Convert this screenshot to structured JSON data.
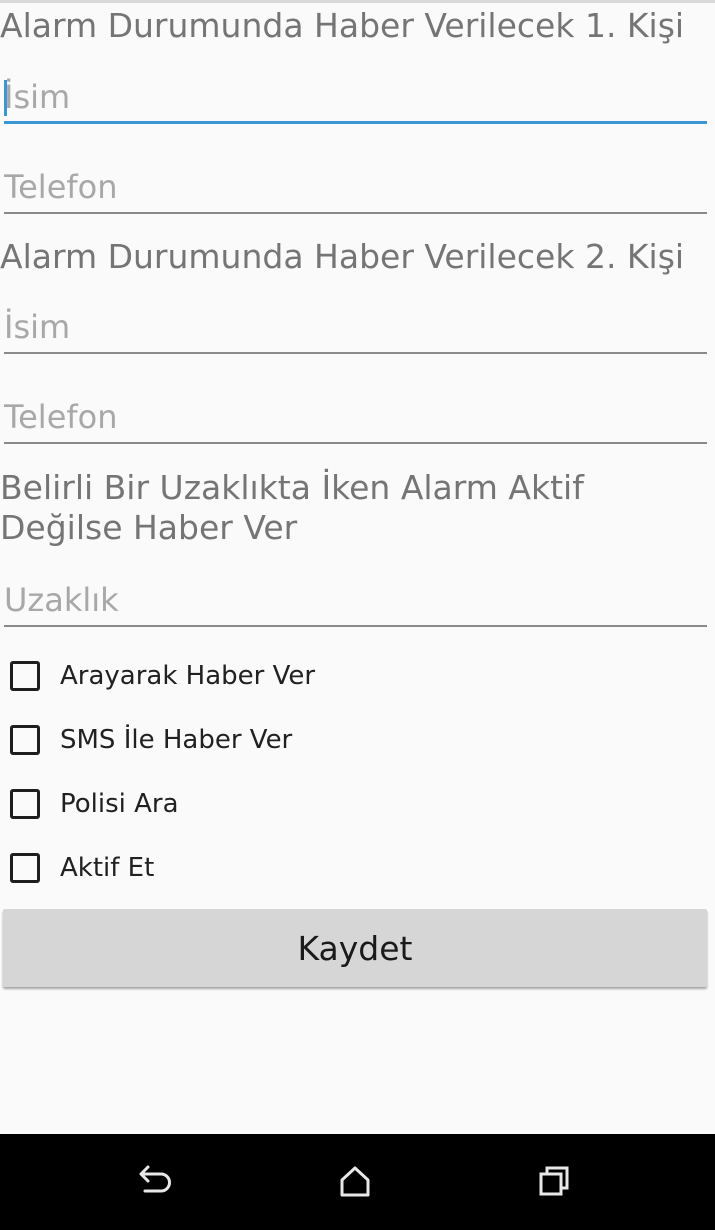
{
  "contact1": {
    "title": "Alarm Durumunda Haber Verilecek 1. Kişi",
    "name_placeholder": "İsim",
    "name_value": "",
    "phone_placeholder": "Telefon",
    "phone_value": ""
  },
  "contact2": {
    "title": "Alarm Durumunda Haber Verilecek 2. Kişi",
    "name_placeholder": "İsim",
    "name_value": "",
    "phone_placeholder": "Telefon",
    "phone_value": ""
  },
  "distance": {
    "title": "Belirli Bir Uzaklıkta İken Alarm Aktif Değilse Haber Ver",
    "placeholder": "Uzaklık",
    "value": ""
  },
  "options": [
    {
      "label": "Arayarak Haber Ver",
      "checked": false
    },
    {
      "label": "SMS İle Haber Ver",
      "checked": false
    },
    {
      "label": "Polisi Ara",
      "checked": false
    },
    {
      "label": "Aktif Et",
      "checked": false
    }
  ],
  "save_label": "Kaydet",
  "navbar": {
    "icons": [
      "back-icon",
      "home-icon",
      "recents-icon"
    ]
  },
  "colors": {
    "accent": "#3a97d4",
    "background": "#fafafa",
    "button": "#d6d6d6",
    "navbar": "#000000"
  }
}
